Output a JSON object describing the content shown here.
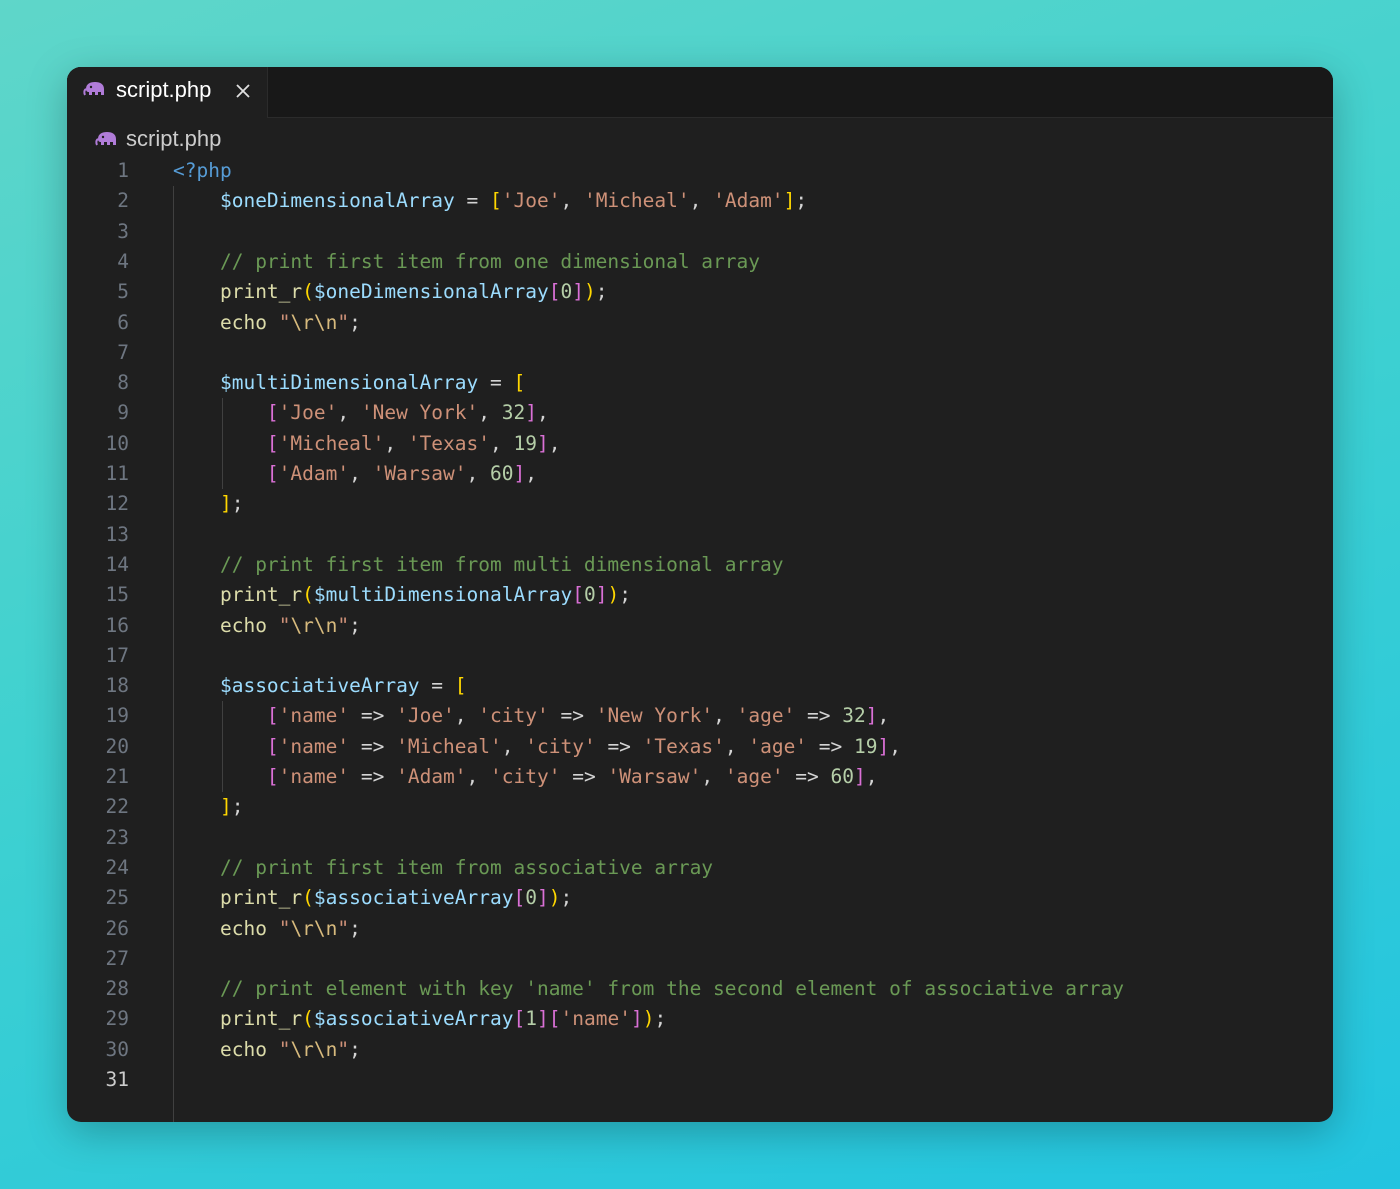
{
  "tab": {
    "title": "script.php",
    "icon": "php-elephant-icon",
    "close_icon": "close-icon"
  },
  "breadcrumb": {
    "file": "script.php",
    "icon": "php-elephant-icon"
  },
  "editor": {
    "active_line": 31,
    "lines": [
      {
        "n": "1",
        "tokens": [
          [
            "<?php",
            "kw"
          ]
        ]
      },
      {
        "n": "2",
        "tokens": [
          [
            "    ",
            ""
          ],
          [
            "$oneDimensionalArray",
            "var"
          ],
          [
            " = ",
            "op"
          ],
          [
            "[",
            "b1"
          ],
          [
            "'Joe'",
            "str"
          ],
          [
            ", ",
            "op"
          ],
          [
            "'Micheal'",
            "str"
          ],
          [
            ", ",
            "op"
          ],
          [
            "'Adam'",
            "str"
          ],
          [
            "]",
            "b1"
          ],
          [
            ";",
            "op"
          ]
        ]
      },
      {
        "n": "3",
        "tokens": []
      },
      {
        "n": "4",
        "tokens": [
          [
            "    ",
            ""
          ],
          [
            "// print first item from one dimensional array",
            "com"
          ]
        ]
      },
      {
        "n": "5",
        "tokens": [
          [
            "    ",
            ""
          ],
          [
            "print_r",
            "fn"
          ],
          [
            "(",
            "b1"
          ],
          [
            "$oneDimensionalArray",
            "var"
          ],
          [
            "[",
            "b2"
          ],
          [
            "0",
            "num"
          ],
          [
            "]",
            "b2"
          ],
          [
            ")",
            "b1"
          ],
          [
            ";",
            "op"
          ]
        ]
      },
      {
        "n": "6",
        "tokens": [
          [
            "    ",
            ""
          ],
          [
            "echo",
            "fn"
          ],
          [
            " ",
            "op"
          ],
          [
            "\"",
            "str"
          ],
          [
            "\\r\\n",
            "esc"
          ],
          [
            "\"",
            "str"
          ],
          [
            ";",
            "op"
          ]
        ]
      },
      {
        "n": "7",
        "tokens": []
      },
      {
        "n": "8",
        "tokens": [
          [
            "    ",
            ""
          ],
          [
            "$multiDimensionalArray",
            "var"
          ],
          [
            " = ",
            "op"
          ],
          [
            "[",
            "b1"
          ]
        ]
      },
      {
        "n": "9",
        "tokens": [
          [
            "        ",
            ""
          ],
          [
            "[",
            "b2"
          ],
          [
            "'Joe'",
            "str"
          ],
          [
            ", ",
            "op"
          ],
          [
            "'New York'",
            "str"
          ],
          [
            ", ",
            "op"
          ],
          [
            "32",
            "num"
          ],
          [
            "]",
            "b2"
          ],
          [
            ",",
            "op"
          ]
        ]
      },
      {
        "n": "10",
        "tokens": [
          [
            "        ",
            ""
          ],
          [
            "[",
            "b2"
          ],
          [
            "'Micheal'",
            "str"
          ],
          [
            ", ",
            "op"
          ],
          [
            "'Texas'",
            "str"
          ],
          [
            ", ",
            "op"
          ],
          [
            "19",
            "num"
          ],
          [
            "]",
            "b2"
          ],
          [
            ",",
            "op"
          ]
        ]
      },
      {
        "n": "11",
        "tokens": [
          [
            "        ",
            ""
          ],
          [
            "[",
            "b2"
          ],
          [
            "'Adam'",
            "str"
          ],
          [
            ", ",
            "op"
          ],
          [
            "'Warsaw'",
            "str"
          ],
          [
            ", ",
            "op"
          ],
          [
            "60",
            "num"
          ],
          [
            "]",
            "b2"
          ],
          [
            ",",
            "op"
          ]
        ]
      },
      {
        "n": "12",
        "tokens": [
          [
            "    ",
            ""
          ],
          [
            "]",
            "b1"
          ],
          [
            ";",
            "op"
          ]
        ]
      },
      {
        "n": "13",
        "tokens": []
      },
      {
        "n": "14",
        "tokens": [
          [
            "    ",
            ""
          ],
          [
            "// print first item from multi dimensional array",
            "com"
          ]
        ]
      },
      {
        "n": "15",
        "tokens": [
          [
            "    ",
            ""
          ],
          [
            "print_r",
            "fn"
          ],
          [
            "(",
            "b1"
          ],
          [
            "$multiDimensionalArray",
            "var"
          ],
          [
            "[",
            "b2"
          ],
          [
            "0",
            "num"
          ],
          [
            "]",
            "b2"
          ],
          [
            ")",
            "b1"
          ],
          [
            ";",
            "op"
          ]
        ]
      },
      {
        "n": "16",
        "tokens": [
          [
            "    ",
            ""
          ],
          [
            "echo",
            "fn"
          ],
          [
            " ",
            "op"
          ],
          [
            "\"",
            "str"
          ],
          [
            "\\r\\n",
            "esc"
          ],
          [
            "\"",
            "str"
          ],
          [
            ";",
            "op"
          ]
        ]
      },
      {
        "n": "17",
        "tokens": []
      },
      {
        "n": "18",
        "tokens": [
          [
            "    ",
            ""
          ],
          [
            "$associativeArray",
            "var"
          ],
          [
            " = ",
            "op"
          ],
          [
            "[",
            "b1"
          ]
        ]
      },
      {
        "n": "19",
        "tokens": [
          [
            "        ",
            ""
          ],
          [
            "[",
            "b2"
          ],
          [
            "'name'",
            "str"
          ],
          [
            " => ",
            "op"
          ],
          [
            "'Joe'",
            "str"
          ],
          [
            ", ",
            "op"
          ],
          [
            "'city'",
            "str"
          ],
          [
            " => ",
            "op"
          ],
          [
            "'New York'",
            "str"
          ],
          [
            ", ",
            "op"
          ],
          [
            "'age'",
            "str"
          ],
          [
            " => ",
            "op"
          ],
          [
            "32",
            "num"
          ],
          [
            "]",
            "b2"
          ],
          [
            ",",
            "op"
          ]
        ]
      },
      {
        "n": "20",
        "tokens": [
          [
            "        ",
            ""
          ],
          [
            "[",
            "b2"
          ],
          [
            "'name'",
            "str"
          ],
          [
            " => ",
            "op"
          ],
          [
            "'Micheal'",
            "str"
          ],
          [
            ", ",
            "op"
          ],
          [
            "'city'",
            "str"
          ],
          [
            " => ",
            "op"
          ],
          [
            "'Texas'",
            "str"
          ],
          [
            ", ",
            "op"
          ],
          [
            "'age'",
            "str"
          ],
          [
            " => ",
            "op"
          ],
          [
            "19",
            "num"
          ],
          [
            "]",
            "b2"
          ],
          [
            ",",
            "op"
          ]
        ]
      },
      {
        "n": "21",
        "tokens": [
          [
            "        ",
            ""
          ],
          [
            "[",
            "b2"
          ],
          [
            "'name'",
            "str"
          ],
          [
            " => ",
            "op"
          ],
          [
            "'Adam'",
            "str"
          ],
          [
            ", ",
            "op"
          ],
          [
            "'city'",
            "str"
          ],
          [
            " => ",
            "op"
          ],
          [
            "'Warsaw'",
            "str"
          ],
          [
            ", ",
            "op"
          ],
          [
            "'age'",
            "str"
          ],
          [
            " => ",
            "op"
          ],
          [
            "60",
            "num"
          ],
          [
            "]",
            "b2"
          ],
          [
            ",",
            "op"
          ]
        ]
      },
      {
        "n": "22",
        "tokens": [
          [
            "    ",
            ""
          ],
          [
            "]",
            "b1"
          ],
          [
            ";",
            "op"
          ]
        ]
      },
      {
        "n": "23",
        "tokens": []
      },
      {
        "n": "24",
        "tokens": [
          [
            "    ",
            ""
          ],
          [
            "// print first item from associative array",
            "com"
          ]
        ]
      },
      {
        "n": "25",
        "tokens": [
          [
            "    ",
            ""
          ],
          [
            "print_r",
            "fn"
          ],
          [
            "(",
            "b1"
          ],
          [
            "$associativeArray",
            "var"
          ],
          [
            "[",
            "b2"
          ],
          [
            "0",
            "num"
          ],
          [
            "]",
            "b2"
          ],
          [
            ")",
            "b1"
          ],
          [
            ";",
            "op"
          ]
        ]
      },
      {
        "n": "26",
        "tokens": [
          [
            "    ",
            ""
          ],
          [
            "echo",
            "fn"
          ],
          [
            " ",
            "op"
          ],
          [
            "\"",
            "str"
          ],
          [
            "\\r\\n",
            "esc"
          ],
          [
            "\"",
            "str"
          ],
          [
            ";",
            "op"
          ]
        ]
      },
      {
        "n": "27",
        "tokens": []
      },
      {
        "n": "28",
        "tokens": [
          [
            "    ",
            ""
          ],
          [
            "// print element with key 'name' from the second element of associative array",
            "com"
          ]
        ]
      },
      {
        "n": "29",
        "tokens": [
          [
            "    ",
            ""
          ],
          [
            "print_r",
            "fn"
          ],
          [
            "(",
            "b1"
          ],
          [
            "$associativeArray",
            "var"
          ],
          [
            "[",
            "b2"
          ],
          [
            "1",
            "num"
          ],
          [
            "]",
            "b2"
          ],
          [
            "[",
            "b2"
          ],
          [
            "'name'",
            "str"
          ],
          [
            "]",
            "b2"
          ],
          [
            ")",
            "b1"
          ],
          [
            ";",
            "op"
          ]
        ]
      },
      {
        "n": "30",
        "tokens": [
          [
            "    ",
            ""
          ],
          [
            "echo",
            "fn"
          ],
          [
            " ",
            "op"
          ],
          [
            "\"",
            "str"
          ],
          [
            "\\r\\n",
            "esc"
          ],
          [
            "\"",
            "str"
          ],
          [
            ";",
            "op"
          ]
        ]
      },
      {
        "n": "31",
        "tokens": []
      }
    ]
  }
}
